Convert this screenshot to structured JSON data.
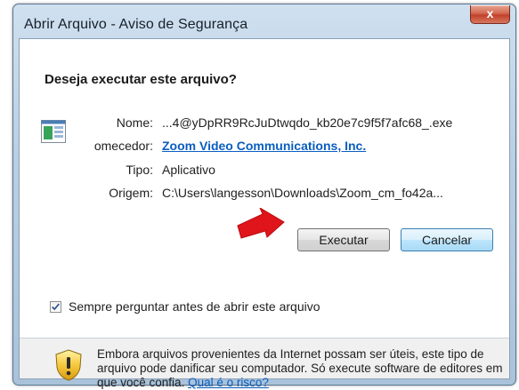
{
  "window": {
    "title": "Abrir Arquivo - Aviso de Segurança",
    "close_label": "x"
  },
  "dialog": {
    "question": "Deseja executar este arquivo?",
    "fields": {
      "name_label": "Nome:",
      "name_value": "...4@yDpRR9RcJuDtwqdo_kb20e7c9f5f7afc68_.exe",
      "publisher_label": "omecedor:",
      "publisher_value": "Zoom Video Communications, Inc.",
      "type_label": "Tipo:",
      "type_value": "Aplicativo",
      "origin_label": "Origem:",
      "origin_value": "C:\\Users\\langesson\\Downloads\\Zoom_cm_fo42a..."
    },
    "buttons": {
      "run": "Executar",
      "cancel": "Cancelar"
    },
    "checkbox": {
      "label": "Sempre perguntar antes de abrir este arquivo",
      "checked": true
    },
    "warning": {
      "text": "Embora arquivos provenientes da Internet possam ser úteis, este tipo de arquivo pode danificar seu computador. Só execute software de editores em que você confia. ",
      "link": "Qual é o risco?"
    }
  },
  "colors": {
    "link": "#0a5ebf",
    "arrow": "#e0151b"
  },
  "icons": [
    "file-icon",
    "close-icon",
    "arrow-icon",
    "check-icon",
    "shield-warning-icon"
  ]
}
